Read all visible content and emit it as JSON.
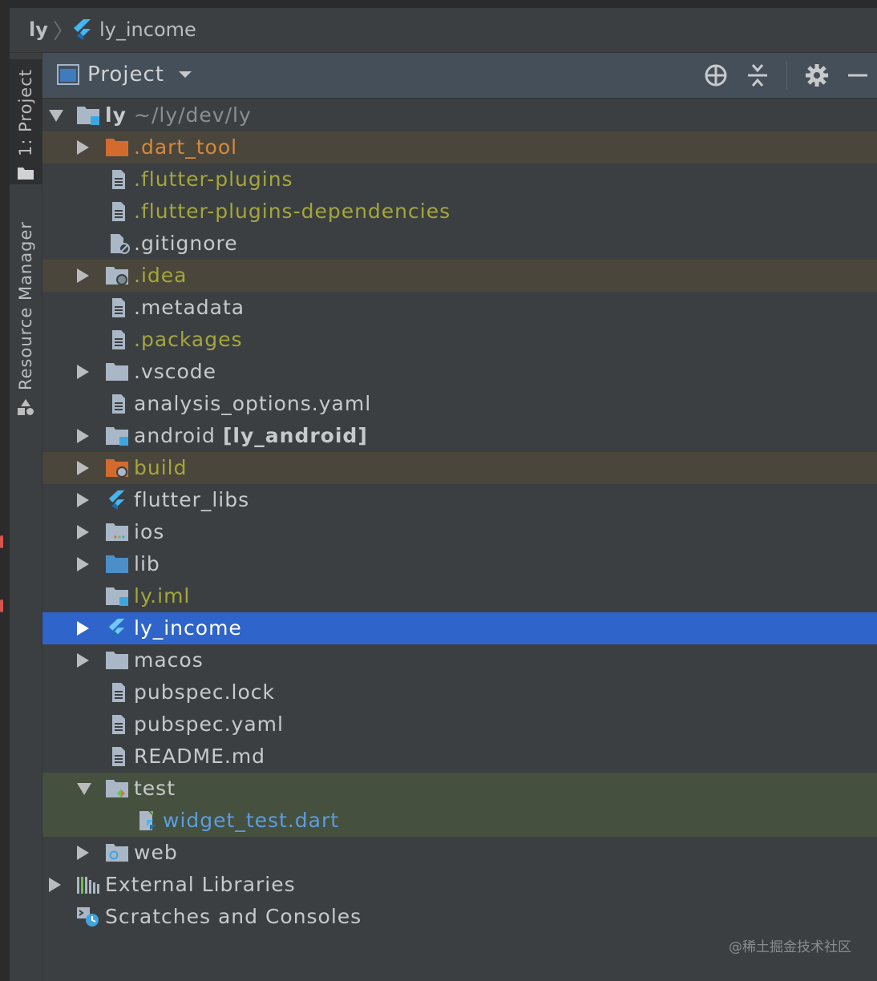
{
  "breadcrumb": {
    "root": "ly",
    "separator": "〉",
    "project": "ly_income"
  },
  "tool_window_bar": {
    "project_tab": "1: Project",
    "resource_tab": "Resource Manager"
  },
  "panel": {
    "title": "Project",
    "tools": [
      "locate-icon",
      "collapse-icon",
      "gear-icon",
      "minimize-icon"
    ]
  },
  "tree": {
    "root": {
      "name": "ly",
      "path": "~/ly/dev/ly"
    },
    "items": [
      {
        "name": ".dart_tool",
        "color": "#d8893b",
        "icon": "folder-excluded-icon",
        "expandable": true
      },
      {
        "name": ".flutter-plugins",
        "color": "#a4a73a",
        "icon": "file-icon",
        "expandable": false
      },
      {
        "name": ".flutter-plugins-dependencies",
        "color": "#a4a73a",
        "icon": "file-icon",
        "expandable": false
      },
      {
        "name": ".gitignore",
        "color": "#c7c9cb",
        "icon": "gitignore-file-icon",
        "expandable": false
      },
      {
        "name": ".idea",
        "color": "#a4a73a",
        "icon": "folder-config-icon",
        "expandable": true
      },
      {
        "name": ".metadata",
        "color": "#c7c9cb",
        "icon": "file-icon",
        "expandable": false
      },
      {
        "name": ".packages",
        "color": "#a4a73a",
        "icon": "file-icon",
        "expandable": false
      },
      {
        "name": ".vscode",
        "color": "#c7c9cb",
        "icon": "folder-icon",
        "expandable": true
      },
      {
        "name": "analysis_options.yaml",
        "color": "#c7c9cb",
        "icon": "file-icon",
        "expandable": false
      },
      {
        "name": "android",
        "module": "[ly_android]",
        "color": "#c7c9cb",
        "icon": "module-folder-icon",
        "expandable": true
      },
      {
        "name": "build",
        "color": "#a4a73a",
        "icon": "folder-excluded-config-icon",
        "expandable": true
      },
      {
        "name": "flutter_libs",
        "color": "#c7c9cb",
        "icon": "flutter-icon",
        "expandable": true
      },
      {
        "name": "ios",
        "color": "#c7c9cb",
        "icon": "folder-ios-icon",
        "expandable": true
      },
      {
        "name": "lib",
        "color": "#c7c9cb",
        "icon": "source-folder-icon",
        "expandable": true
      },
      {
        "name": "ly.iml",
        "color": "#a4a73a",
        "icon": "module-file-icon",
        "expandable": false
      },
      {
        "name": "ly_income",
        "color": "#ffffff",
        "icon": "flutter-icon",
        "expandable": true,
        "selected": true
      },
      {
        "name": "macos",
        "color": "#c7c9cb",
        "icon": "folder-icon",
        "expandable": true
      },
      {
        "name": "pubspec.lock",
        "color": "#c7c9cb",
        "icon": "file-icon",
        "expandable": false
      },
      {
        "name": "pubspec.yaml",
        "color": "#c7c9cb",
        "icon": "file-icon",
        "expandable": false
      },
      {
        "name": "README.md",
        "color": "#c7c9cb",
        "icon": "file-icon",
        "expandable": false
      },
      {
        "name": "test",
        "color": "#c7c9cb",
        "icon": "test-folder-icon",
        "expandable": true,
        "expanded": true
      },
      {
        "name": "widget_test.dart",
        "color": "#5c9cde",
        "icon": "dart-test-file-icon",
        "expandable": false,
        "child": true
      },
      {
        "name": "web",
        "color": "#c7c9cb",
        "icon": "web-folder-icon",
        "expandable": true
      }
    ],
    "external_libraries": "External Libraries",
    "scratches": "Scratches and Consoles"
  },
  "watermark": "@稀土掘金技术社区"
}
